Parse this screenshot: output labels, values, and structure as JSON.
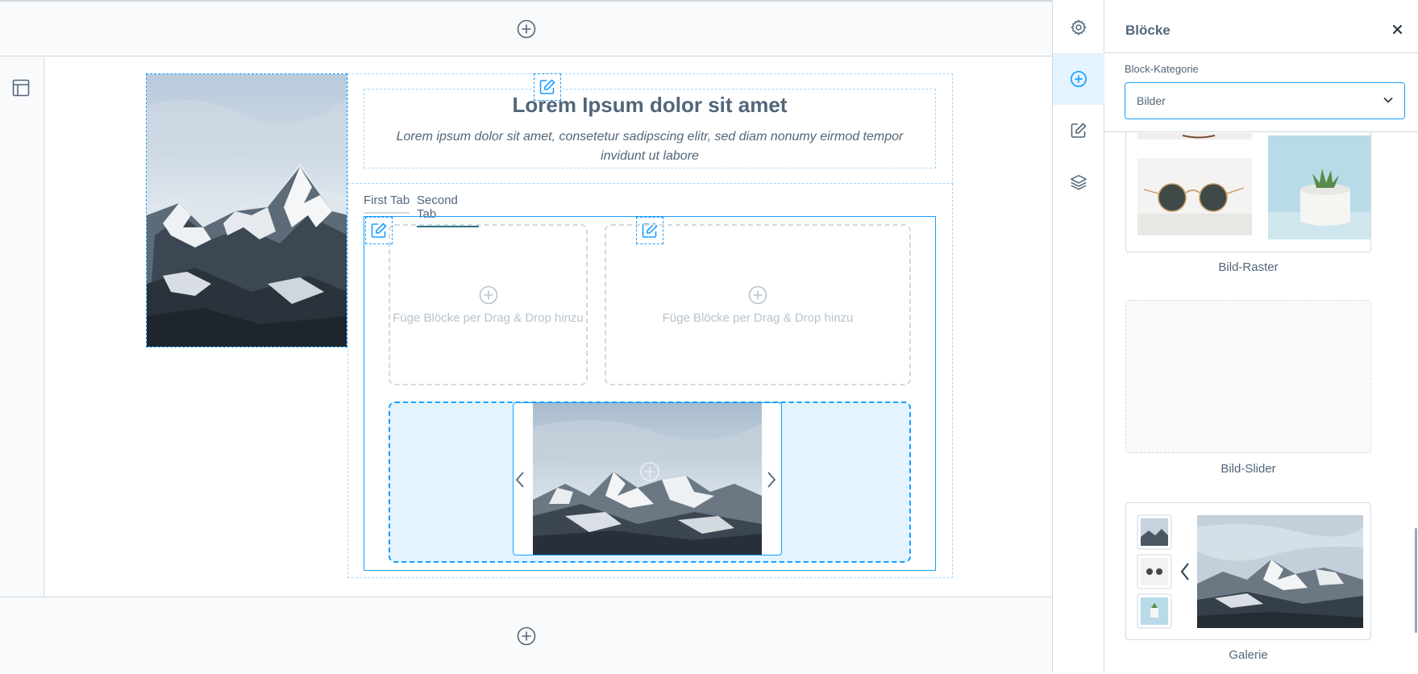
{
  "canvas": {
    "headline": "Lorem Ipsum dolor sit amet",
    "body_text": "Lorem ipsum dolor sit amet, consetetur sadipscing elitr, sed diam nonumy eirmod tempor invidunt ut labore",
    "tabs": [
      {
        "label": "First Tab",
        "active": false
      },
      {
        "label": "Second Tab",
        "active": true
      }
    ],
    "drop_zone_left": "Füge Blöcke per Drag & Drop hinzu",
    "drop_zone_right": "Füge Blöcke per Drag & Drop hinzu"
  },
  "rail": {
    "items": [
      {
        "icon": "gear-icon",
        "active": false
      },
      {
        "icon": "plus-circle-icon",
        "active": true
      },
      {
        "icon": "edit-icon",
        "active": false
      },
      {
        "icon": "layers-icon",
        "active": false
      }
    ]
  },
  "sidebar": {
    "title": "Blöcke",
    "category_label": "Block-Kategorie",
    "category_value": "Bilder",
    "blocks": [
      {
        "name": "Bild-Raster"
      },
      {
        "name": "Bild-Slider"
      },
      {
        "name": "Galerie"
      }
    ]
  },
  "colors": {
    "accent": "#189eff",
    "text": "#52667a",
    "border": "#d1d9e0",
    "active_bg": "#e3f3ff",
    "tab_active": "#2a7680"
  }
}
